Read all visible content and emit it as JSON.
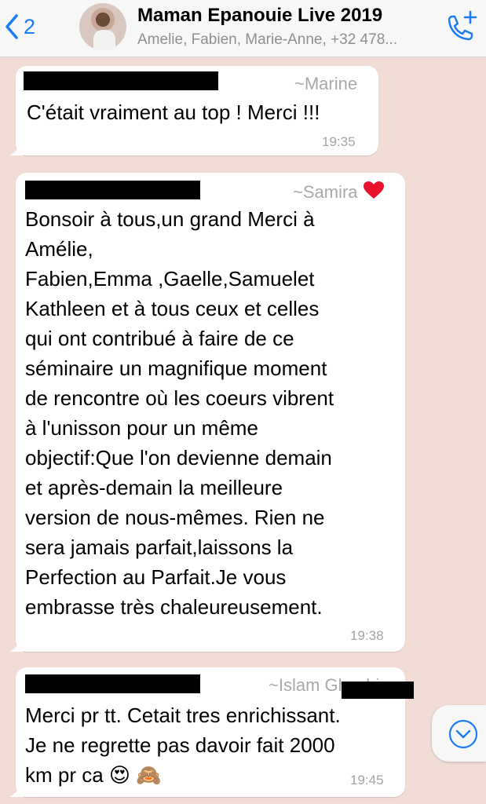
{
  "header": {
    "back_count": "2",
    "title": "Maman Epanouie Live 2019",
    "subtitle": "Amelie, Fabien, Marie-Anne, +32 478...",
    "icons": {
      "back": "chevron-left-icon",
      "call": "phone-add-icon"
    }
  },
  "messages": [
    {
      "sender": "~Marine",
      "text": "C'était vraiment au top ! Merci !!!",
      "time": "19:35"
    },
    {
      "sender": "~Samira",
      "text": "Bonsoir à tous,un grand Merci à\nAmélie,\nFabien,Emma ,Gaelle,Samuelet\nKathleen et à tous ceux et celles\nqui ont contribué à faire de ce\nséminaire un magnifique moment\nde rencontre où les coeurs vibrent\nà l'unisson pour un même\nobjectif:Que l'on devienne demain\net après-demain la meilleure\nversion de nous-mêmes. Rien ne\nsera jamais parfait,laissons la\nPerfection au Parfait.Je vous\nembrasse très chaleureusement.",
      "time": "19:38"
    },
    {
      "sender": "~Islam Ghachi",
      "text": "Merci pr tt. Cetait tres enrichissant.\nJe ne regrette pas davoir fait 2000\nkm pr ca 😍 🙈",
      "time": "19:45"
    }
  ],
  "colors": {
    "background": "#f1dcd6",
    "accent": "#1a7cf5",
    "bubble": "#ffffff",
    "meta_text": "#a4a4a4"
  }
}
